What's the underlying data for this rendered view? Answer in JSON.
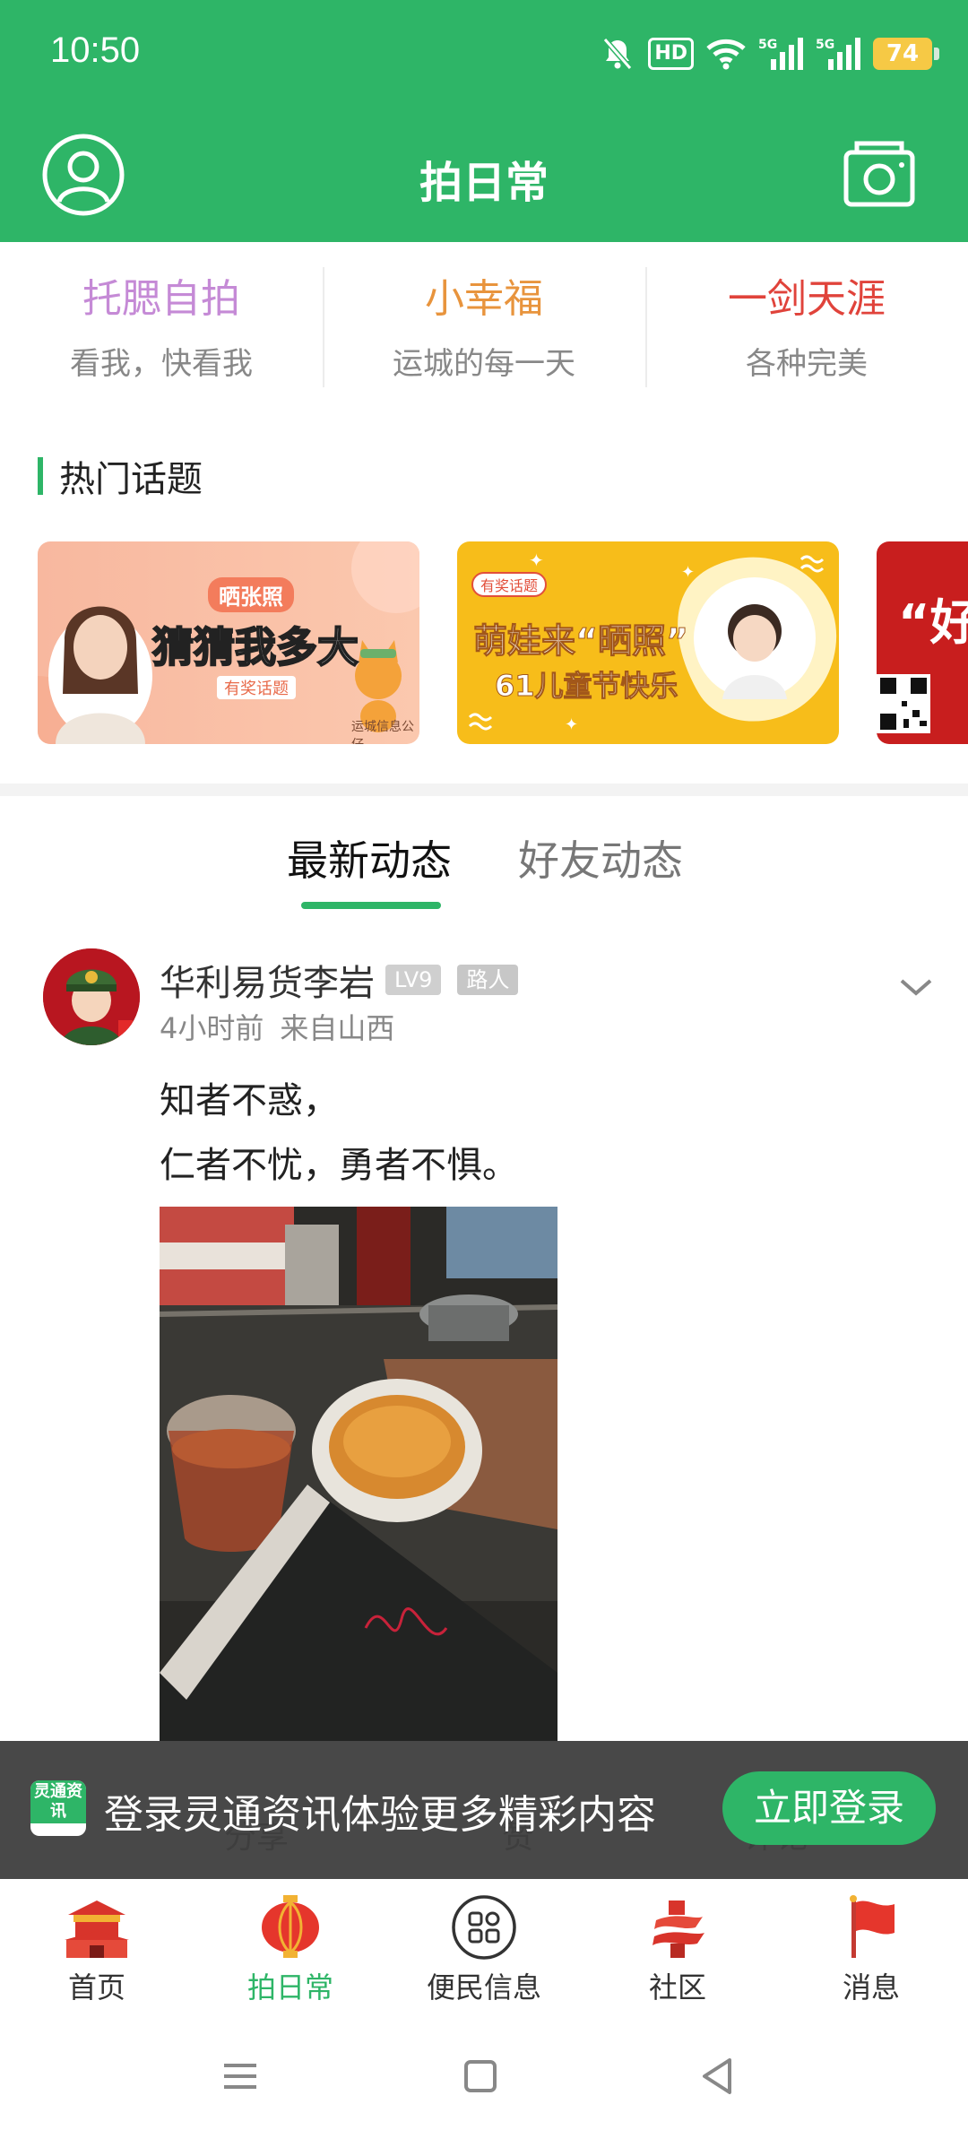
{
  "status_bar": {
    "time": "10:50",
    "hd_label": "HD",
    "net1": "5G",
    "net2": "5G",
    "battery": "74"
  },
  "header": {
    "title": "拍日常"
  },
  "shortcuts": [
    {
      "name": "托腮自拍",
      "sub": "看我，快看我",
      "color": "#c58ad6"
    },
    {
      "name": "小幸福",
      "sub": "运城的每一天",
      "color": "#e8943d"
    },
    {
      "name": "一剑天涯",
      "sub": "各种完美",
      "color": "#e0433b"
    }
  ],
  "topics": {
    "heading": "热门话题",
    "banners": [
      {
        "tag": "晒张照",
        "headline": "猜猜我多大",
        "badge": "有奖话题",
        "footer": "运城信息公仔"
      },
      {
        "tag": "有奖话题",
        "headline": "萌娃来“晒照”",
        "sub": "61儿童节快乐"
      },
      {
        "headline": "“好"
      }
    ]
  },
  "feed_tabs": {
    "latest": "最新动态",
    "friends": "好友动态"
  },
  "post": {
    "username": "华利易货李岩",
    "level": "LV9",
    "role": "路人",
    "time": "4小时前",
    "location": "来自山西",
    "line1": "知者不惑，",
    "line2": "仁者不忧，勇者不惧。",
    "actions": {
      "share": "分享",
      "like": "赞",
      "comment": "评论"
    }
  },
  "login_bar": {
    "logo_text": "灵通资讯",
    "message": "登录灵通资讯体验更多精彩内容",
    "button": "立即登录"
  },
  "bottom_nav": [
    {
      "label": "首页",
      "icon": "palace-icon"
    },
    {
      "label": "拍日常",
      "icon": "lantern-icon"
    },
    {
      "label": "便民信息",
      "icon": "grid-circle-icon"
    },
    {
      "label": "社区",
      "icon": "tower-icon"
    },
    {
      "label": "消息",
      "icon": "flag-icon"
    }
  ],
  "colors": {
    "brand_green": "#2eb567"
  }
}
